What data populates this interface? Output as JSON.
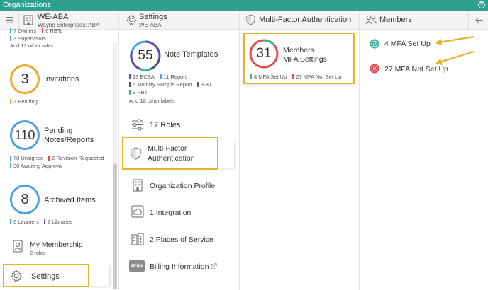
{
  "app": {
    "title": "Organizations",
    "help_label": "?"
  },
  "org_column": {
    "name": "WE-ABA",
    "subtitle": "Wayne Enterprises: ABA",
    "top_tags": [
      {
        "text": "7 Owners",
        "color": "#3cb29a"
      },
      {
        "text": "6 RBTs",
        "color": "#e04c4c"
      },
      {
        "text": "3 Supervisors",
        "color": "#4da3e0"
      }
    ],
    "other_roles": "And 12 other roles",
    "invitations": {
      "count": "3",
      "label": "Invitations",
      "color": "#f2a52c",
      "tags": [
        {
          "text": "3 Pending",
          "color": "#f2a52c"
        }
      ]
    },
    "pending": {
      "count": "110",
      "label_line1": "Pending",
      "label_line2": "Notes/Reports",
      "color": "#4da3e0",
      "tags": [
        {
          "text": "78 Unsigned",
          "color": "#4da3e0"
        },
        {
          "text": "2 Revision Requested",
          "color": "#e04c4c"
        },
        {
          "text": "30 Awaiting Approval",
          "color": "#4da3e0"
        }
      ]
    },
    "archived": {
      "count": "8",
      "label": "Archived Items",
      "color": "#4da3e0",
      "tags": [
        {
          "text": "6 Learners",
          "color": "#4da3e0"
        },
        {
          "text": "2 Libraries",
          "color": "#6a4bb0"
        }
      ]
    },
    "membership": {
      "label": "My Membership",
      "sub": "2 roles"
    },
    "settings": {
      "label": "Settings"
    }
  },
  "settings_column": {
    "title": "Settings",
    "subtitle": "WE-ABA",
    "note_templates": {
      "count": "55",
      "label": "Note Templates",
      "tags": [
        {
          "text": "13 BCBA",
          "color": "#6a4bb0"
        },
        {
          "text": "11 Report",
          "color": "#4da3e0"
        },
        {
          "text": "6 Motivity Sample Report",
          "color": "#555555"
        },
        {
          "text": "3 BT",
          "color": "#6a4bb0"
        },
        {
          "text": "3 RBT",
          "color": "#3cb29a"
        }
      ],
      "other": "And 18 other labels"
    },
    "items": {
      "roles": "17 Roles",
      "mfa_line1": "Multi-Factor",
      "mfa_line2": "Authentication",
      "profile": "Organization Profile",
      "integration": "1 Integration",
      "places": "2 Places of Service",
      "billing": "Billing Information",
      "stripe": "stripe"
    }
  },
  "mfa_column": {
    "title": "Multi-Factor Authentication",
    "card": {
      "count": "31",
      "line1": "Members",
      "line2": "MFA Settings",
      "tags": [
        {
          "text": "4 MFA Set Up",
          "color": "#3cb29a"
        },
        {
          "text": "27 MFA Not Set Up",
          "color": "#e04c4c"
        }
      ]
    }
  },
  "members_column": {
    "title": "Members",
    "rows": [
      {
        "text": "4 MFA Set Up",
        "color": "#3cb29a"
      },
      {
        "text": "27 MFA Not Set Up",
        "color": "#e04c4c"
      }
    ]
  },
  "colors": {
    "accent": "#2f9f8f",
    "highlight": "#e8b32c",
    "arrow": "#e8b32c"
  }
}
